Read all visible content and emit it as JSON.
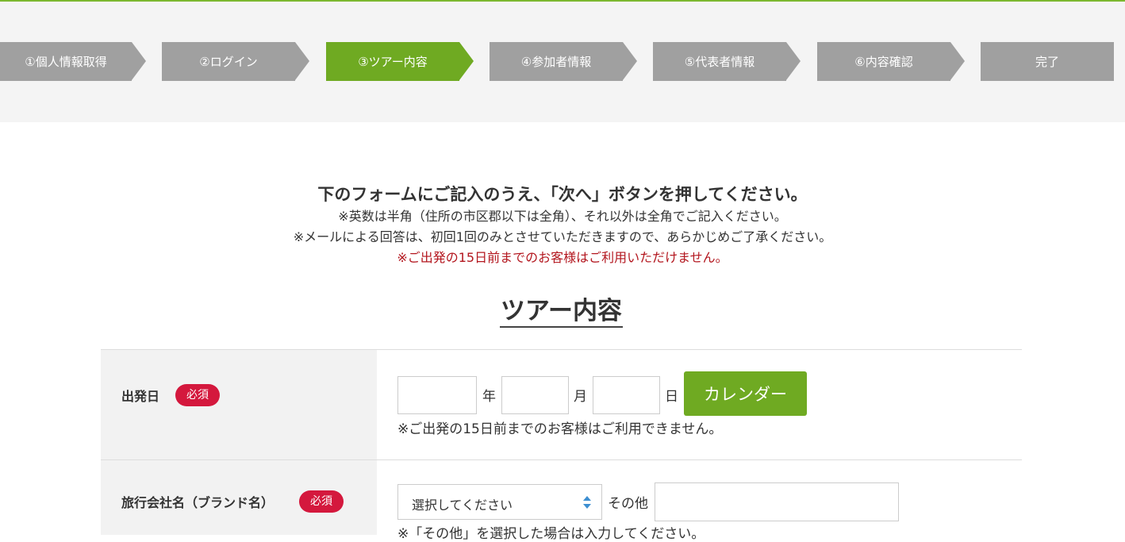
{
  "steps": [
    {
      "label": "①個人情報取得",
      "active": false
    },
    {
      "label": "②ログイン",
      "active": false
    },
    {
      "label": "③ツアー内容",
      "active": true
    },
    {
      "label": "④参加者情報",
      "active": false
    },
    {
      "label": "⑤代表者情報",
      "active": false
    },
    {
      "label": "⑥内容確認",
      "active": false
    },
    {
      "label": "完了",
      "active": false
    }
  ],
  "intro": {
    "lead": "下のフォームにご記入のうえ、「次へ」ボタンを押してください。",
    "line1": "※英数は半角（住所の市区郡以下は全角）、それ以外は全角でご記入ください。",
    "line2": "※メールによる回答は、初回1回のみとさせていただきますので、あらかじめご了承ください。",
    "warning": "※ご出発の15日前までのお客様はご利用いただけません。"
  },
  "section_title": "ツアー内容",
  "form": {
    "departure": {
      "label": "出発日",
      "required": "必須",
      "year_unit": "年",
      "month_unit": "月",
      "day_unit": "日",
      "year_value": "",
      "month_value": "",
      "day_value": "",
      "calendar_button": "カレンダー",
      "note": "※ご出発の15日前までのお客様はご利用できません。"
    },
    "travel_agency": {
      "label": "旅行会社名（ブランド名）",
      "required": "必須",
      "select_value": "選択してください",
      "other_label": "その他",
      "other_value": "",
      "note": "※「その他」を選択した場合は入力してください。"
    }
  },
  "colors": {
    "accent_green": "#6faa22",
    "step_gray": "#a0a0a0",
    "required_red": "#d4183d",
    "warning_red": "#b3161e"
  }
}
